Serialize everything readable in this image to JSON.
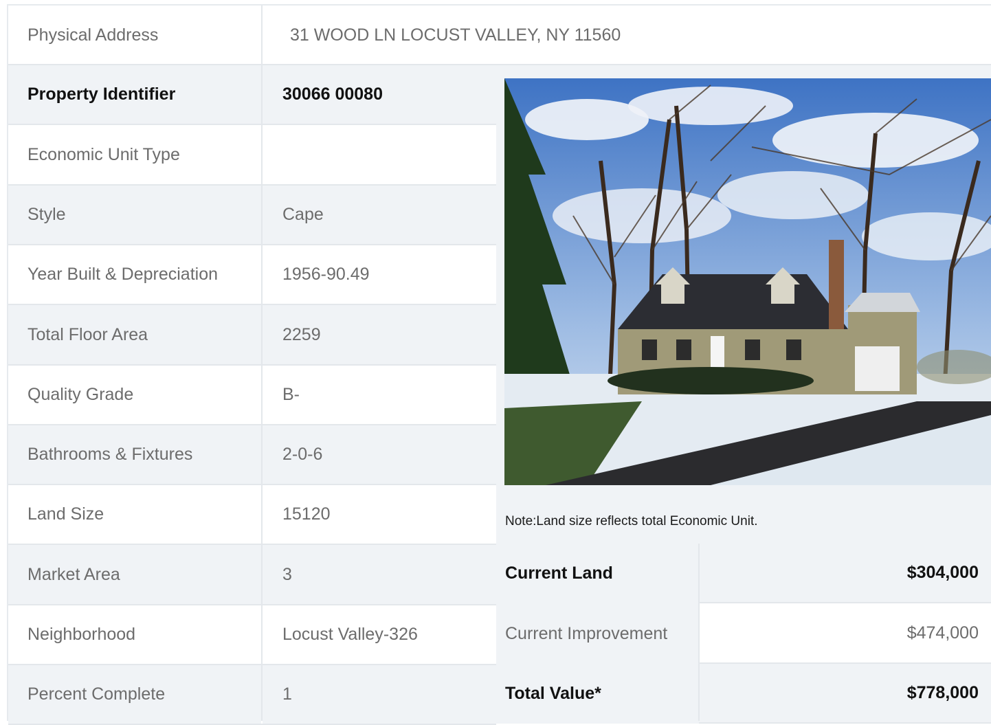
{
  "address": {
    "label": "Physical Address",
    "value": "31  WOOD LN  LOCUST VALLEY, NY  11560"
  },
  "details": [
    {
      "label": "Property Identifier",
      "value": "30066  00080",
      "bold": true
    },
    {
      "label": "Economic Unit Type",
      "value": ""
    },
    {
      "label": "Style",
      "value": "Cape"
    },
    {
      "label": "Year Built & Depreciation",
      "value": "1956-90.49"
    },
    {
      "label": "Total Floor Area",
      "value": "2259"
    },
    {
      "label": "Quality Grade",
      "value": "B-"
    },
    {
      "label": "Bathrooms & Fixtures",
      "value": "2-0-6"
    },
    {
      "label": "Land Size",
      "value": "15120"
    },
    {
      "label": "Market Area",
      "value": "3"
    },
    {
      "label": "Neighborhood",
      "value": "Locust Valley-326"
    },
    {
      "label": "Percent Complete",
      "value": "1"
    }
  ],
  "note": "Note:Land size reflects total Economic Unit.",
  "valuation": [
    {
      "label": "Current Land",
      "value": "$304,000",
      "bold": true
    },
    {
      "label": "Current Improvement",
      "value": "$474,000",
      "bold": false
    },
    {
      "label": "Total Value*",
      "value": "$778,000",
      "bold": true
    }
  ],
  "photo": {
    "icon": "house-photo"
  }
}
